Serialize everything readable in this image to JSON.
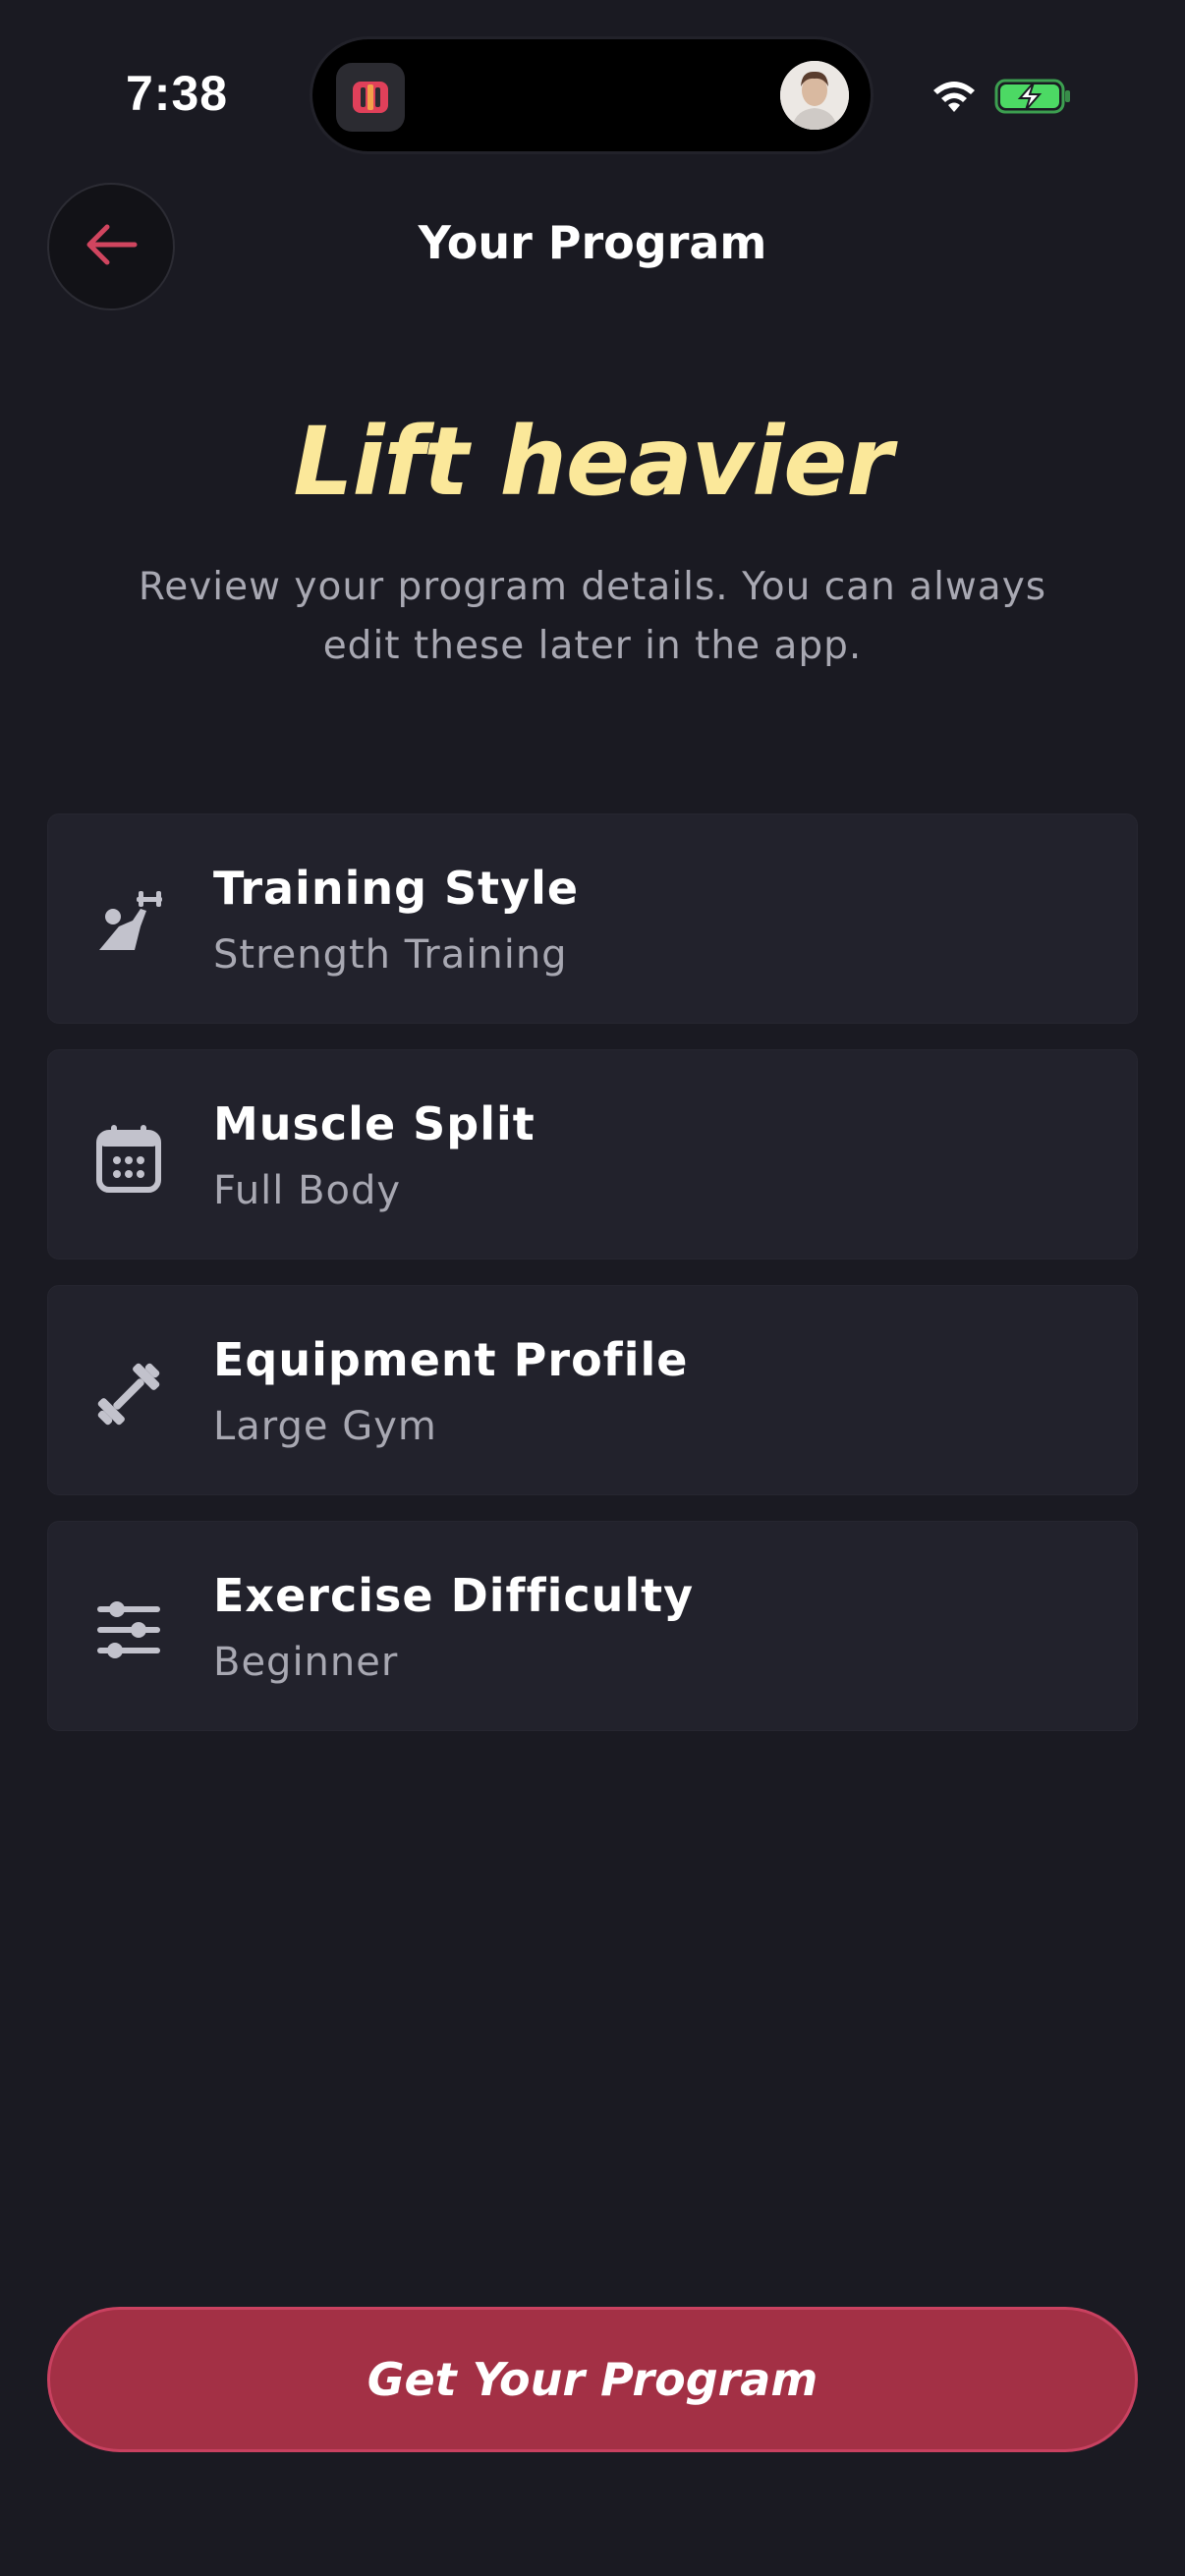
{
  "status_bar": {
    "time": "7:38",
    "icons": [
      "app-icon",
      "avatar",
      "wifi-icon",
      "battery-charging-icon"
    ],
    "battery_color": "#4cd964"
  },
  "header": {
    "back_icon": "arrow-left-icon",
    "title": "Your Program"
  },
  "hero": {
    "title": "Lift heavier",
    "subtitle": "Review your program details. You can always edit these later in the app."
  },
  "cards": [
    {
      "icon": "weightlifter-icon",
      "title": "Training Style",
      "value": "Strength Training"
    },
    {
      "icon": "calendar-icon",
      "title": "Muscle Split",
      "value": "Full Body"
    },
    {
      "icon": "dumbbell-icon",
      "title": "Equipment Profile",
      "value": "Large Gym"
    },
    {
      "icon": "sliders-icon",
      "title": "Exercise Difficulty",
      "value": "Beginner"
    }
  ],
  "cta": {
    "label": "Get Your Program"
  },
  "colors": {
    "background": "#1a1a22",
    "card": "#22222c",
    "accent": "#a33045",
    "hero_text": "#fbe89a",
    "back_arrow": "#d0455f"
  }
}
